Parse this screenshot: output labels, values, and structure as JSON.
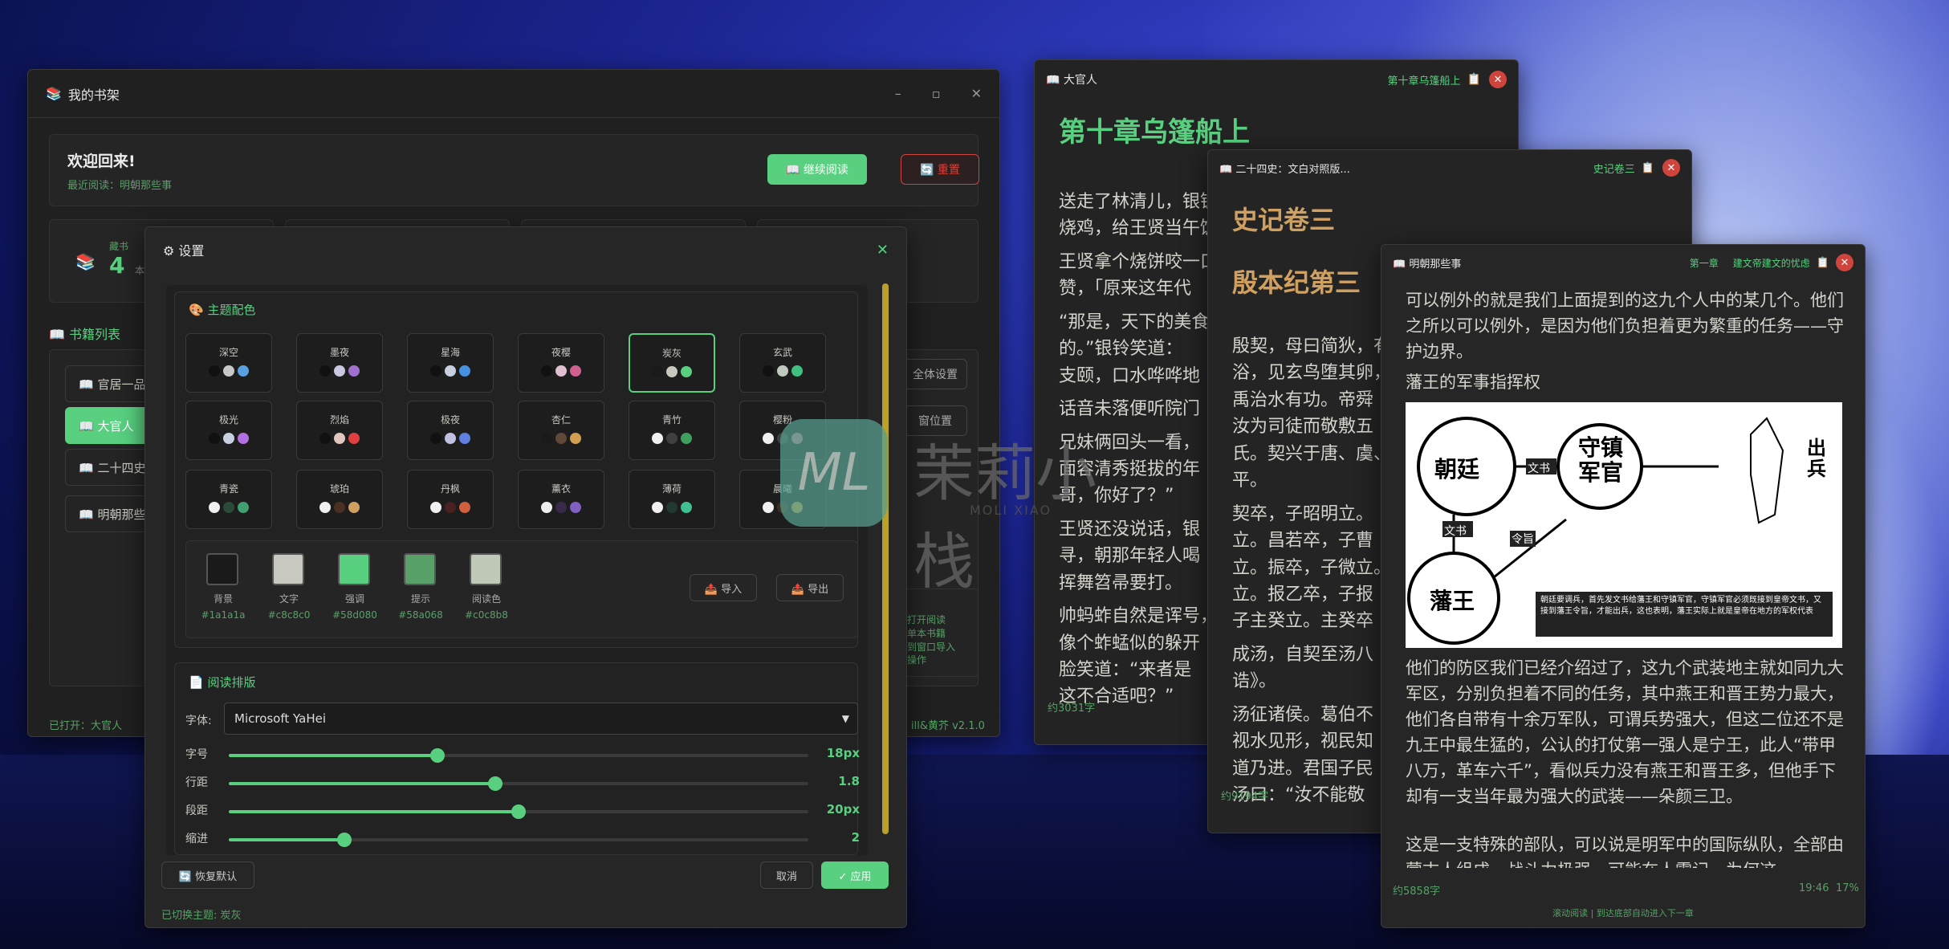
{
  "bookshelf": {
    "title": "我的书架",
    "welcome": "欢迎回来!",
    "last_read": "最近阅读：明朝那些事",
    "continue_label": "📖 继续阅读",
    "reset_label": "🔄 重置",
    "stat_label": "藏书",
    "stat_value": "4",
    "stat_unit": "本",
    "list_title": "📖 书籍列表",
    "books": [
      "📖 官居一品",
      "📖 大官人",
      "📖 二十四史",
      "📖 明朝那些"
    ],
    "side_btns": [
      "全体设置",
      "窗位置"
    ],
    "help_lines": [
      "打开阅读",
      "单本书籍",
      "到窗口导入",
      "操作"
    ],
    "status_left": "已打开：大官人",
    "status_right": "ill&黄芥  v2.1.0"
  },
  "settings": {
    "title": "⚙ 设置",
    "section_theme": "🎨 主题配色",
    "themes": [
      {
        "name": "深空",
        "dots": [
          "#111111",
          "#c8c8c8",
          "#58a0e0"
        ]
      },
      {
        "name": "墨夜",
        "dots": [
          "#111111",
          "#c8c8e0",
          "#a070d0"
        ]
      },
      {
        "name": "星海",
        "dots": [
          "#111111",
          "#c8d0e0",
          "#4890e0"
        ]
      },
      {
        "name": "夜樱",
        "dots": [
          "#111111",
          "#e0c0d0",
          "#d06090"
        ]
      },
      {
        "name": "炭灰",
        "dots": [
          "#1a1a1a",
          "#c8c8c0",
          "#58d080"
        ]
      },
      {
        "name": "玄武",
        "dots": [
          "#111111",
          "#c0c8c0",
          "#40c080"
        ]
      },
      {
        "name": "极光",
        "dots": [
          "#111111",
          "#c8d0e0",
          "#b070e0"
        ]
      },
      {
        "name": "烈焰",
        "dots": [
          "#111111",
          "#e0c8c0",
          "#e04040"
        ]
      },
      {
        "name": "极夜",
        "dots": [
          "#111111",
          "#c0c0e0",
          "#6080e0"
        ]
      },
      {
        "name": "杏仁",
        "dots": [
          "#1a1a1a",
          "#604838",
          "#d0a050"
        ]
      },
      {
        "name": "青竹",
        "dots": [
          "#f0f0f0",
          "#404040",
          "#40a060"
        ]
      },
      {
        "name": "樱粉",
        "dots": [
          "#f0f0f0",
          "#404040",
          "#d08090"
        ]
      },
      {
        "name": "青瓷",
        "dots": [
          "#f0f0f0",
          "#2a4a3a",
          "#40a070"
        ]
      },
      {
        "name": "琥珀",
        "dots": [
          "#f0f0f0",
          "#4a3020",
          "#d0a060"
        ]
      },
      {
        "name": "丹枫",
        "dots": [
          "#f0f0f0",
          "#4a2020",
          "#d06040"
        ]
      },
      {
        "name": "薰衣",
        "dots": [
          "#f0f0f0",
          "#3a2a4a",
          "#8060c0"
        ]
      },
      {
        "name": "薄荷",
        "dots": [
          "#f0f0f0",
          "#203a30",
          "#40c090"
        ]
      },
      {
        "name": "晨曦",
        "dots": [
          "#f0f0f0",
          "#3a3020",
          "#d0a040"
        ]
      }
    ],
    "custom_colors": [
      {
        "label": "背景",
        "hex": "#1a1a1a"
      },
      {
        "label": "文字",
        "hex": "#c8c8c0"
      },
      {
        "label": "强调",
        "hex": "#58d080"
      },
      {
        "label": "提示",
        "hex": "#58a068"
      },
      {
        "label": "阅读色",
        "hex": "#c0c8b8"
      }
    ],
    "import_label": "📤 导入",
    "export_label": "📤 导出",
    "section_layout": "📄 阅读排版",
    "font_label": "字体:",
    "font_value": "Microsoft YaHei",
    "sliders": [
      {
        "label": "字号",
        "value": "18px",
        "pct": 0.36
      },
      {
        "label": "行距",
        "value": "1.8",
        "pct": 0.46
      },
      {
        "label": "段距",
        "value": "20px",
        "pct": 0.5
      },
      {
        "label": "缩进",
        "value": "2",
        "pct": 0.2
      }
    ],
    "restore_label": "🔄 恢复默认",
    "cancel_label": "取消",
    "apply_label": "✓ 应用",
    "status": "已切换主题: 炭灰"
  },
  "watermark": {
    "logo": "ML",
    "cn": "茉莉小栈",
    "en": "MOLI XIAO"
  },
  "reader1": {
    "title": "📖 大官人",
    "chapter_link": "第十章乌篷船上",
    "chapter": "第十章乌篷船上",
    "paras": [
      "送走了林清儿，银锭、",
      "烧鸡，给王贤当午饭。",
      "王贤拿个烧饼咬一口，",
      "赞，「原来这年代",
      "“那是，天下的美食",
      "的。”银铃笑道：",
      "支颐，口水哗哗地",
      "话音未落便听院门",
      "兄妹俩回头一看，",
      "面容清秀挺拔的年",
      "哥，你好了？”",
      "王贤还没说话，银",
      "寻，朝那年轻人喝",
      "挥舞笤帚要打。",
      "帅蚂蚱自然是诨号，",
      "像个蚱蜢似的躲开",
      "脸笑道：“来者是",
      "这不合适吧？”"
    ],
    "count": "约3031字"
  },
  "reader2": {
    "title": "📖 二十四史：文白对照版...",
    "chapter_link": "史记卷三",
    "h1": "史记卷三",
    "h2": "殷本纪第三",
    "paras": [
      "殷契，母曰简狄，有",
      "浴，见玄鸟堕其卵，",
      "禹治水有功。帝舜",
      "汝为司徒而敬敷五",
      "氏。契兴于唐、虞、",
      "平。",
      "契卒，子昭明立。",
      "立。昌若卒，子曹",
      "立。振卒，子微立。",
      "立。报乙卒，子报",
      "子主癸立。主癸卒",
      "成汤，自契至汤八",
      "诰》。",
      "汤征诸侯。葛伯不",
      "视水见形，视民知",
      "道乃进。君国子民",
      "汤曰：“汝不能敬"
    ],
    "count": "约9194字"
  },
  "reader3": {
    "title": "📖 明朝那些事",
    "chapter_link": "第一章",
    "chapter_link2": "建文帝建文的忧虑",
    "p1": "可以例外的就是我们上面提到的这九个人中的某几个。他们之所以可以例外，是因为他们负担着更为繁重的任务——守护边界。",
    "p2": "藩王的军事指挥权",
    "diagram": {
      "n1": "朝廷",
      "n2": "守镇军官",
      "n3": "藩王",
      "n4": "出兵",
      "a1": "文书",
      "a2": "文书",
      "a3": "令旨",
      "caption": "朝廷要调兵，首先发文书给藩王和守镇军官，守镇军官必须既接到皇帝文书，又接到藩王令旨，才能出兵，这也表明，藩王实际上就是皇帝在地方的军权代表"
    },
    "p3": "他们的防区我们已经介绍过了，这九个武装地主就如同九大军区，分别负担着不同的任务，其中燕王和晋王势力最大，他们各自带有十余万军队，可谓兵势强大，但这二位还不是九王中最生猛的，公认的打仗第一强人是宁王，此人“带甲八万，革车六千”，看似兵力没有燕王和晋王多，但他手下却有一支当年最为强大的武装——朵颜三卫。",
    "p4": "这是一支特殊的部队，可以说是明军中的国际纵队，全部由蒙古人组成，战斗力极强，可能在人需记，为何这",
    "count": "约5858字",
    "time": "19:46",
    "pct": "17%",
    "hint": "滚动阅读 | 到达底部自动进入下一章"
  }
}
